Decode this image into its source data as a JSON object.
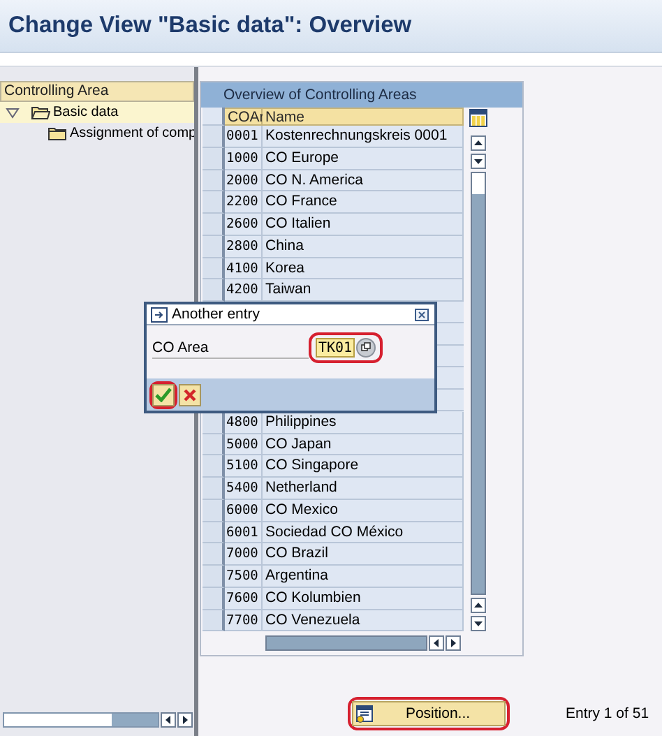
{
  "window": {
    "title": "Change View \"Basic data\": Overview"
  },
  "tree": {
    "header": "Controlling Area",
    "items": [
      {
        "label": "Basic data",
        "expanded": true,
        "selected": true,
        "children": [
          {
            "label": "Assignment of comp",
            "selected": false
          }
        ]
      }
    ]
  },
  "table": {
    "title": "Overview of Controlling Areas",
    "columns": [
      "COAr",
      "Name"
    ],
    "rows": [
      {
        "code": "0001",
        "name": "Kostenrechnungskreis 0001"
      },
      {
        "code": "1000",
        "name": "CO Europe"
      },
      {
        "code": "2000",
        "name": "CO N. America"
      },
      {
        "code": "2200",
        "name": "CO France"
      },
      {
        "code": "2600",
        "name": "CO Italien"
      },
      {
        "code": "2800",
        "name": "China"
      },
      {
        "code": "4100",
        "name": "Korea"
      },
      {
        "code": "4200",
        "name": "Taiwan"
      },
      {
        "code": "4800",
        "name": "Philippines"
      },
      {
        "code": "5000",
        "name": "CO Japan"
      },
      {
        "code": "5100",
        "name": "CO Singapore"
      },
      {
        "code": "5400",
        "name": "Netherland"
      },
      {
        "code": "6000",
        "name": "CO Mexico"
      },
      {
        "code": "6001",
        "name": "Sociedad CO México"
      },
      {
        "code": "7000",
        "name": "CO Brazil"
      },
      {
        "code": "7500",
        "name": "Argentina"
      },
      {
        "code": "7600",
        "name": "CO Kolumbien"
      },
      {
        "code": "7700",
        "name": "CO Venezuela"
      }
    ]
  },
  "dialog": {
    "title": "Another entry",
    "field": {
      "label": "CO Area",
      "value": "TK01",
      "highlighted": true
    },
    "ok_button": {
      "highlighted": true
    }
  },
  "position_button": {
    "label": "Position...",
    "highlighted": true
  },
  "entry_count": "Entry 1 of 51"
}
